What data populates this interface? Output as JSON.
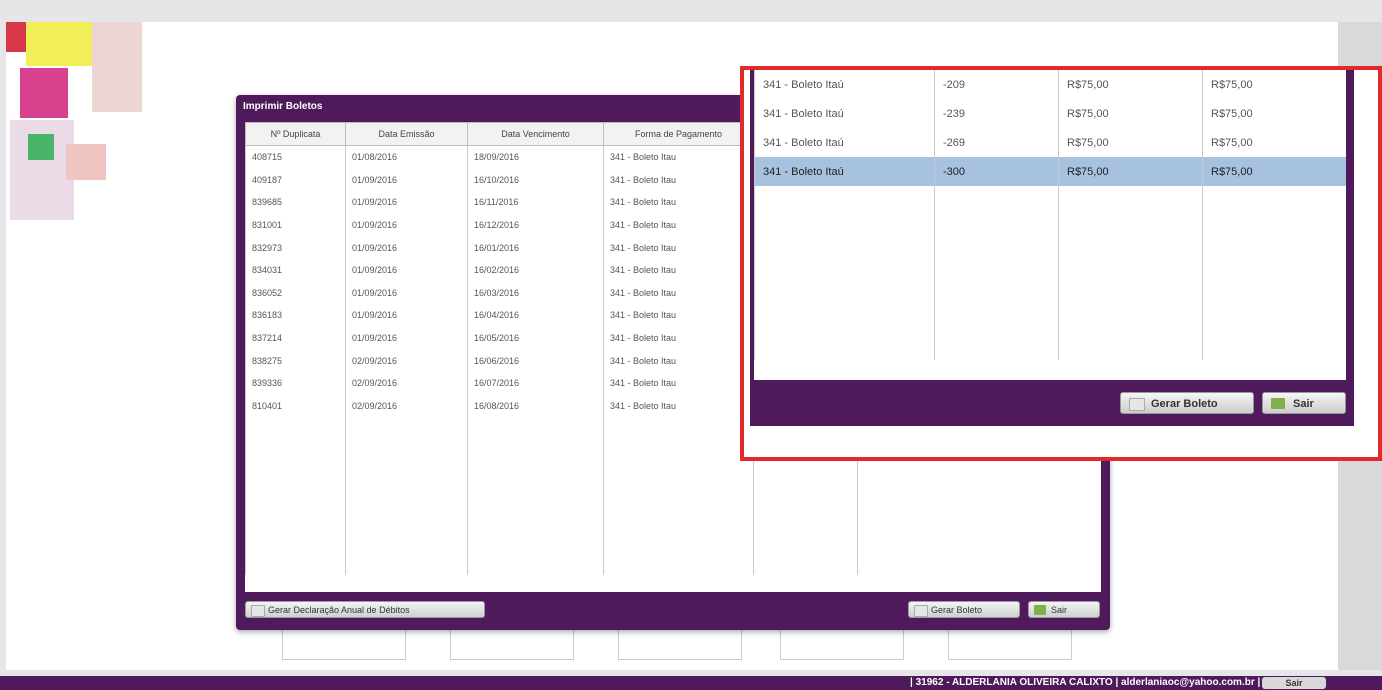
{
  "dialog": {
    "title": "Imprimir Boletos",
    "columns": [
      "Nº Duplicata",
      "Data Emissão",
      "Data Vencimento",
      "Forma de Pagamento"
    ],
    "rows": [
      [
        "408715",
        "01/08/2016",
        "18/09/2016",
        "341 - Boleto Itau"
      ],
      [
        "409187",
        "01/09/2016",
        "16/10/2016",
        "341 - Boleto Itau"
      ],
      [
        "839685",
        "01/09/2016",
        "16/11/2016",
        "341 - Boleto Itau"
      ],
      [
        "831001",
        "01/09/2016",
        "16/12/2016",
        "341 - Boleto Itau"
      ],
      [
        "832973",
        "01/09/2016",
        "16/01/2016",
        "341 - Boleto Itau"
      ],
      [
        "834031",
        "01/09/2016",
        "16/02/2016",
        "341 - Boleto Itau"
      ],
      [
        "836052",
        "01/09/2016",
        "16/03/2016",
        "341 - Boleto Itau"
      ],
      [
        "836183",
        "01/09/2016",
        "16/04/2016",
        "341 - Boleto Itau"
      ],
      [
        "837214",
        "01/09/2016",
        "16/05/2016",
        "341 - Boleto Itau"
      ],
      [
        "838275",
        "02/09/2016",
        "16/06/2016",
        "341 - Boleto Itau"
      ],
      [
        "839336",
        "02/09/2016",
        "16/07/2016",
        "341 - Boleto Itau"
      ],
      [
        "810401",
        "02/09/2016",
        "16/08/2016",
        "341 - Boleto Itau"
      ]
    ],
    "buttons": {
      "declaracao": "Gerar Declaração Anual de Débitos",
      "gerar_boleto": "Gerar Boleto",
      "sair": "Sair"
    }
  },
  "zoom": {
    "rows": [
      [
        "341 - Boleto Itaú",
        "-209",
        "R$75,00",
        "R$75,00"
      ],
      [
        "341 - Boleto Itaú",
        "-239",
        "R$75,00",
        "R$75,00"
      ],
      [
        "341 - Boleto Itaú",
        "-269",
        "R$75,00",
        "R$75,00"
      ],
      [
        "341 - Boleto Itaú",
        "-300",
        "R$75,00",
        "R$75,00"
      ]
    ],
    "selected_index": 3,
    "buttons": {
      "gerar_boleto": "Gerar Boleto",
      "sair": "Sair"
    }
  },
  "footer": {
    "text": "| 31962 - ALDERLANIA OLIVEIRA CALIXTO | alderlaniaoc@yahoo.com.br | V8.1.2",
    "button": "Sair"
  },
  "colors": {
    "brand_purple": "#4f1a5c",
    "highlight_red": "#e12a2a",
    "selection_blue": "#a7c2de"
  }
}
